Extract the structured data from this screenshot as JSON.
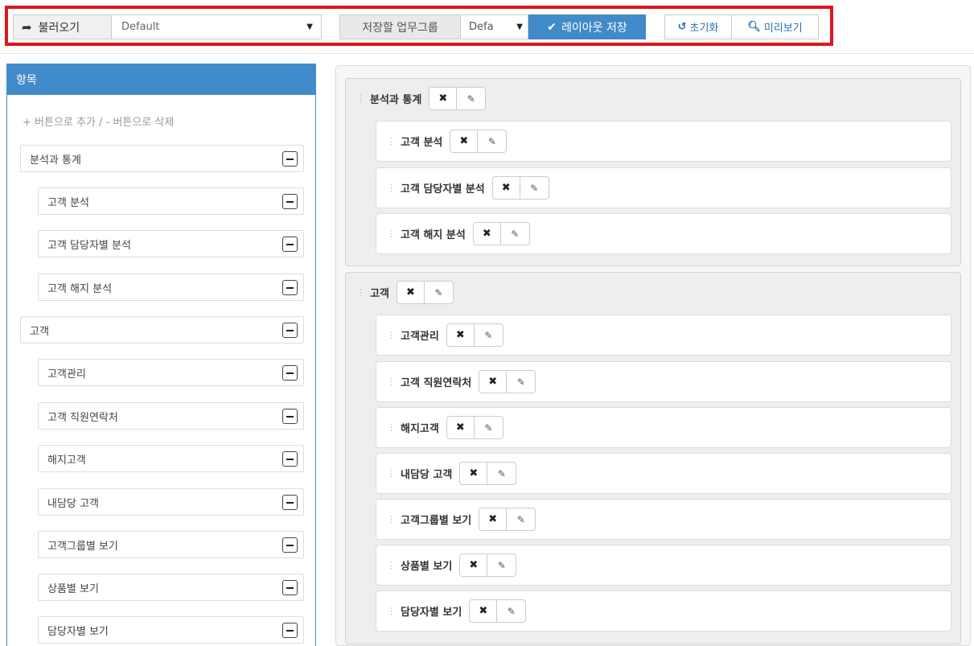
{
  "toolbar": {
    "load_label": "불러오기",
    "load_icon": "share-arrow-icon",
    "layout_select_value": "Default",
    "group_label": "저장할 업무그룹",
    "group_select_value": "Defa",
    "save_label": "레이아웃 저장",
    "save_icon": "check-icon",
    "reset_label": "초기화",
    "reset_icon": "undo-icon",
    "preview_label": "미리보기",
    "preview_icon": "search-icon"
  },
  "left_panel": {
    "title": "항목",
    "hint": "+ 버튼으로 추가 / - 버튼으로 삭제",
    "items": [
      "분석과 통계",
      "고객 분석",
      "고객 담당자별 분석",
      "고객 해지 분석",
      "고객",
      "고객관리",
      "고객 직원연락처",
      "해지고객",
      "내담당 고객",
      "고객그룹별 보기",
      "상품별 보기",
      "담당자별 보기"
    ]
  },
  "layout": {
    "groups": [
      {
        "title": "분석과 통계",
        "items": [
          "고객 분석",
          "고객 담당자별 분석",
          "고객 해지 분석"
        ]
      },
      {
        "title": "고객",
        "items": [
          "고객관리",
          "고객 직원연락처",
          "해지고객",
          "내담당 고객",
          "고객그룹별 보기",
          "상품별 보기",
          "담당자별 보기"
        ]
      }
    ]
  },
  "icons": {
    "delete": "✖",
    "edit": "✎",
    "grip": "⋮"
  }
}
